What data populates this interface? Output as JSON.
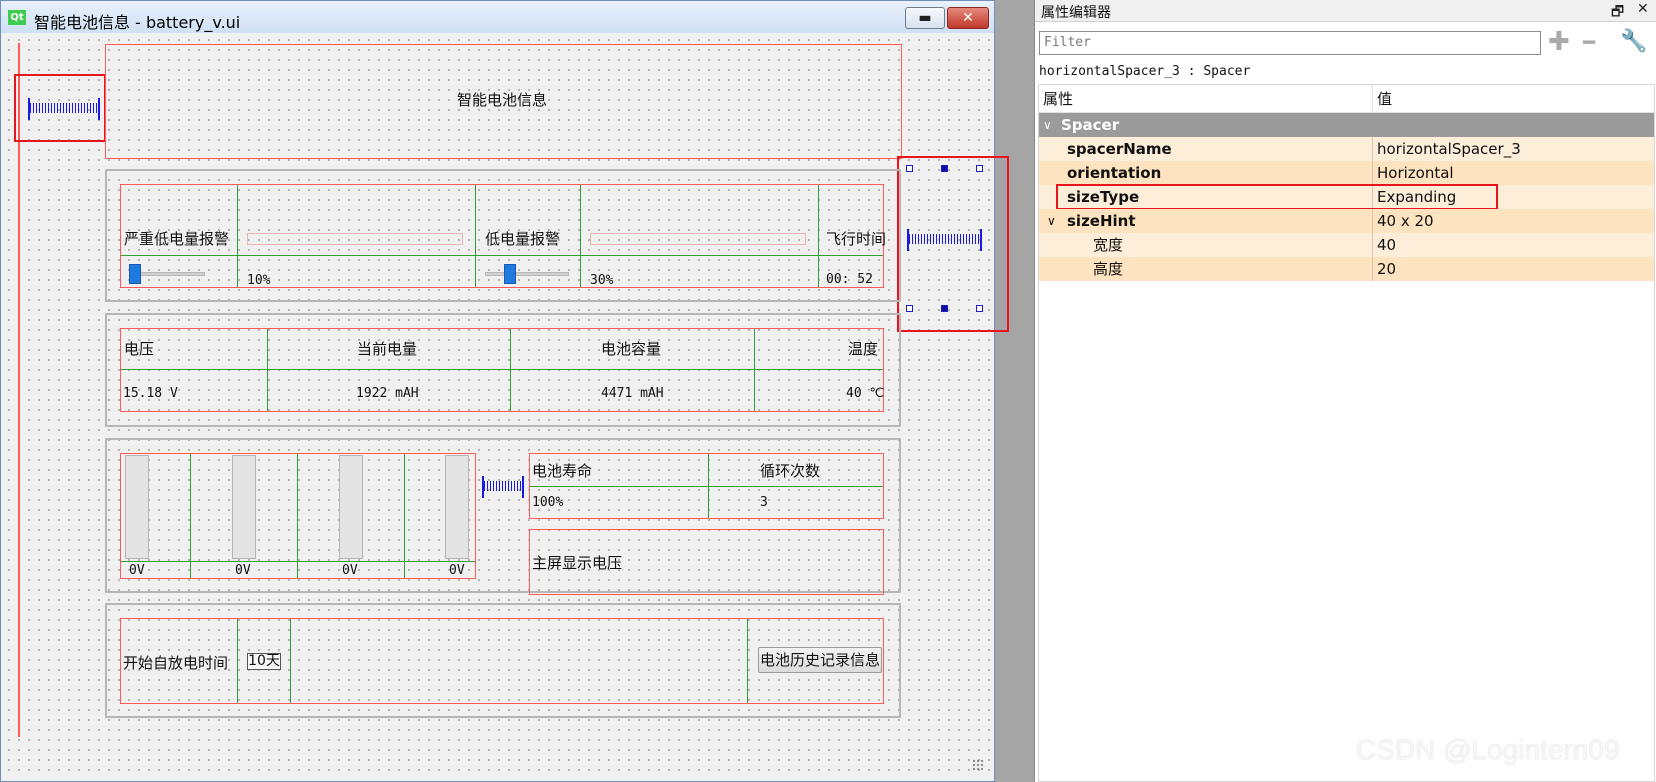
{
  "window": {
    "title": "智能电池信息 - battery_v.ui",
    "logo_text": "Qt",
    "minimize_label": "▬",
    "close_label": "✕"
  },
  "form": {
    "header_label": "智能电池信息",
    "alarm": {
      "critical_label": "严重低电量报警",
      "critical_value": "10%",
      "critical_level": 0.1,
      "low_label": "低电量报警",
      "low_value": "30%",
      "low_level": 0.3,
      "flight_label": "飞行时间",
      "flight_value": "00: 52"
    },
    "info": {
      "voltage_label": "电压",
      "voltage_value": "15.18 V",
      "current_charge_label": "当前电量",
      "current_charge_value": "1922 mAH",
      "capacity_label": "电池容量",
      "capacity_value": "4471 mAH",
      "temp_label": "温度",
      "temp_value": "40 ℃"
    },
    "cells": [
      {
        "value": "0V"
      },
      {
        "value": "0V"
      },
      {
        "value": "0V"
      },
      {
        "value": "0V"
      }
    ],
    "life": {
      "life_label": "电池寿命",
      "cycles_label": "循环次数",
      "life_value": "100%",
      "cycles_value": "3",
      "main_voltage_label": "主屏显示电压"
    },
    "history": {
      "self_discharge_label": "开始自放电时间",
      "self_discharge_value": "10天",
      "history_button": "电池历史记录信息"
    }
  },
  "property_editor": {
    "title": "属性编辑器",
    "float_icon": "🗗",
    "close_icon": "✕",
    "filter_placeholder": "Filter",
    "add_icon": "✚",
    "remove_icon": "━",
    "config_icon": "🔧",
    "object_line": "horizontalSpacer_3 : Spacer",
    "col_property": "属性",
    "col_value": "值",
    "group": "Spacer",
    "rows": [
      {
        "name": "spacerName",
        "value": "horizontalSpacer_3"
      },
      {
        "name": "orientation",
        "value": "Horizontal"
      },
      {
        "name": "sizeType",
        "value": "Expanding"
      },
      {
        "name": "sizeHint",
        "value": "40 x 20"
      },
      {
        "name": "宽度",
        "value": "40"
      },
      {
        "name": "高度",
        "value": "20"
      }
    ]
  },
  "watermark": "CSDN @Logintern09",
  "colors": {
    "layout_border": "#ff5a5a",
    "grid_line": "#31a031",
    "spacer": "#1b1be0",
    "slider_handle": "#1f7ae0",
    "row_highlight": "#fde3bf",
    "group_header": "#9b9b9b"
  }
}
